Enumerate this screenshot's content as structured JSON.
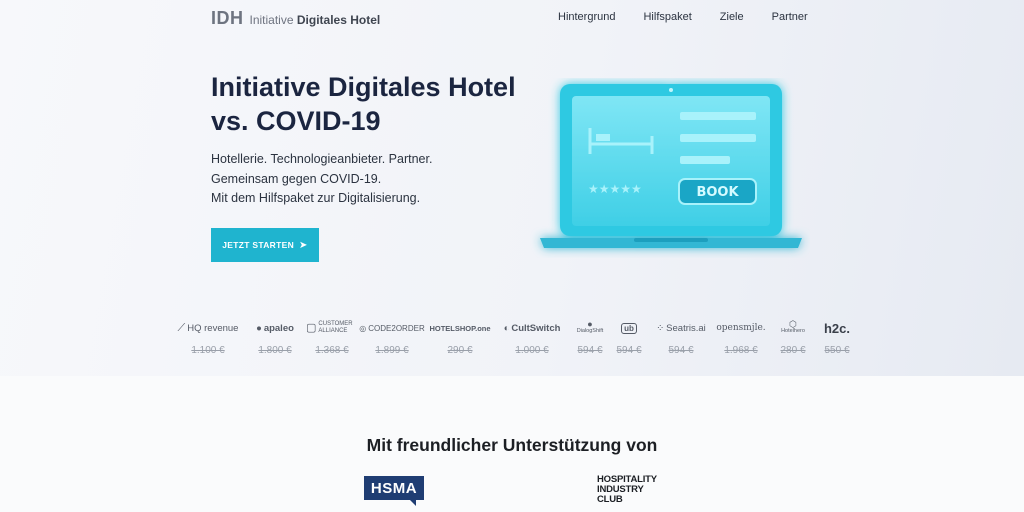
{
  "header": {
    "logo_mark": "IDH",
    "logo_prefix": "Initiative",
    "logo_suffix": "Digitales Hotel",
    "nav": [
      "Hintergrund",
      "Hilfspaket",
      "Ziele",
      "Partner"
    ]
  },
  "hero": {
    "title": "Initiative Digitales Hotel\nvs. COVID-19",
    "subtitle": [
      "Hotellerie. Technologieanbieter. Partner.",
      "Gemeinsam gegen COVID-19.",
      "Mit dem Hilfspaket zur Digitalisierung."
    ],
    "cta_label": "JETZT STARTEN",
    "illustration": {
      "book_label": "BOOK",
      "stars": 5,
      "accent_color": "#2ed3ec"
    }
  },
  "partners": [
    {
      "name": "HQ revenue",
      "price": "1.100 €"
    },
    {
      "name": "apaleo",
      "price": "1.800 €"
    },
    {
      "name": "CUSTOMER ALLIANCE",
      "price": "1.368 €"
    },
    {
      "name": "CODE2ORDER",
      "price": "1.899 €"
    },
    {
      "name": "HOTELSHOP.one",
      "price": "290 €"
    },
    {
      "name": "CultSwitch",
      "price": "1.000 €"
    },
    {
      "name": "DialogShift",
      "price": "594 €"
    },
    {
      "name": "ub",
      "price": "594 €"
    },
    {
      "name": "Seatris.ai",
      "price": "594 €"
    },
    {
      "name": "opensmjle.",
      "price": "1.968 €"
    },
    {
      "name": "Hotelhero",
      "price": "280 €"
    },
    {
      "name": "h2c.",
      "price": "550 €"
    }
  ],
  "support": {
    "title": "Mit freundlicher Unterstützung von",
    "sponsors": [
      "HSMA",
      "HOSPITALITY\nINDUSTRY\nCLUB"
    ]
  },
  "colors": {
    "accent": "#1fb4cf",
    "title": "#1b2540",
    "hsma_blue": "#1f3d73"
  }
}
